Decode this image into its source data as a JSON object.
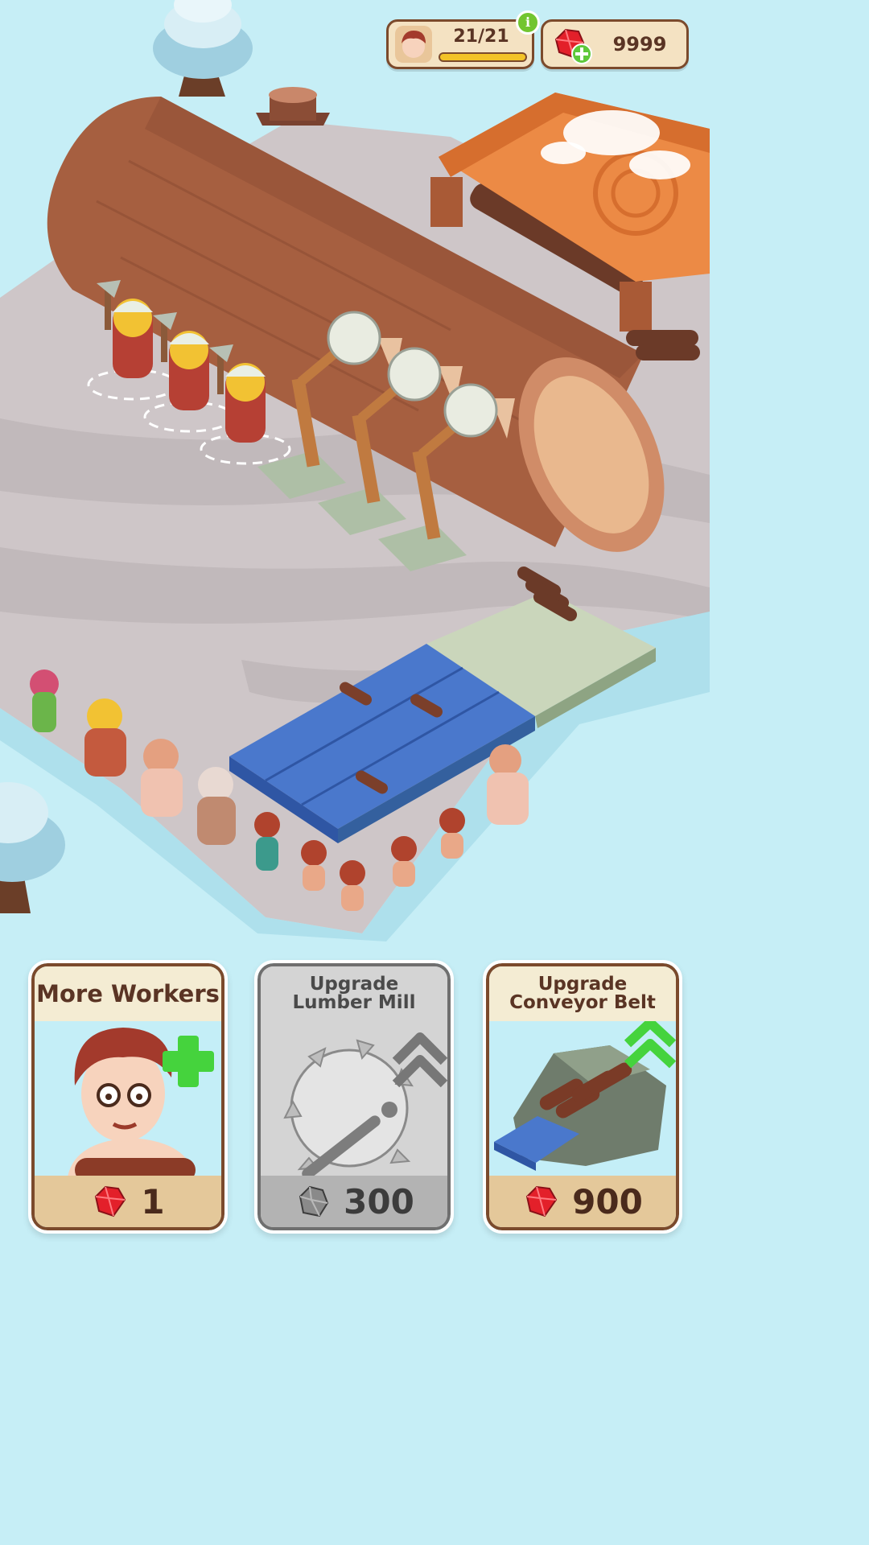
{
  "hud": {
    "workers": {
      "count_label": "21/21",
      "fill_fraction": 1.0,
      "info_label": "i"
    },
    "gems": {
      "value": "9999"
    }
  },
  "cards": {
    "more_workers": {
      "title": "More Workers",
      "price": "1",
      "currency_icon": "ruby-gem-icon",
      "available": true
    },
    "upgrade_lumber_mill": {
      "title": "Upgrade Lumber Mill",
      "price": "300",
      "currency_icon": "stone-icon",
      "available": false
    },
    "upgrade_conveyor_belt": {
      "title": "Upgrade Conveyor Belt",
      "price": "900",
      "currency_icon": "ruby-gem-icon",
      "available": true
    }
  },
  "colors": {
    "sky_snow": "#c6eef6",
    "ground": "#cdc5c8",
    "log": "#a35f3f",
    "conveyor": "#4a78cc",
    "card_border": "#7b4a2c",
    "gem_red": "#e3202a",
    "plus_green": "#45d33d"
  }
}
